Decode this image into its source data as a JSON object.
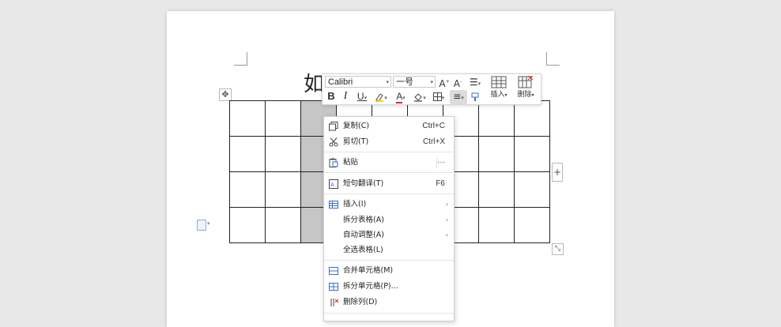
{
  "document": {
    "heading_char": "如"
  },
  "mini_toolbar": {
    "font_name": "Calibri",
    "font_size": "一号",
    "insert_label": "插入",
    "delete_label": "删除"
  },
  "context_menu": {
    "items": [
      {
        "label": "复制(C)",
        "shortcut": "Ctrl+C"
      },
      {
        "label": "剪切(T)",
        "shortcut": "Ctrl+X"
      },
      {
        "label": "粘贴",
        "shortcut": "···"
      },
      {
        "label": "短句翻译(T)",
        "shortcut": "F6"
      },
      {
        "label": "插入(I)"
      },
      {
        "label": "拆分表格(A)"
      },
      {
        "label": "自动调整(A)"
      },
      {
        "label": "全选表格(L)"
      },
      {
        "label": "合并单元格(M)"
      },
      {
        "label": "拆分单元格(P)..."
      },
      {
        "label": "删除列(D)"
      }
    ]
  },
  "colors": {
    "selected_column": "#c6c6c6",
    "highlight_red": "#e02020",
    "icon_blue": "#3a6fc4"
  }
}
